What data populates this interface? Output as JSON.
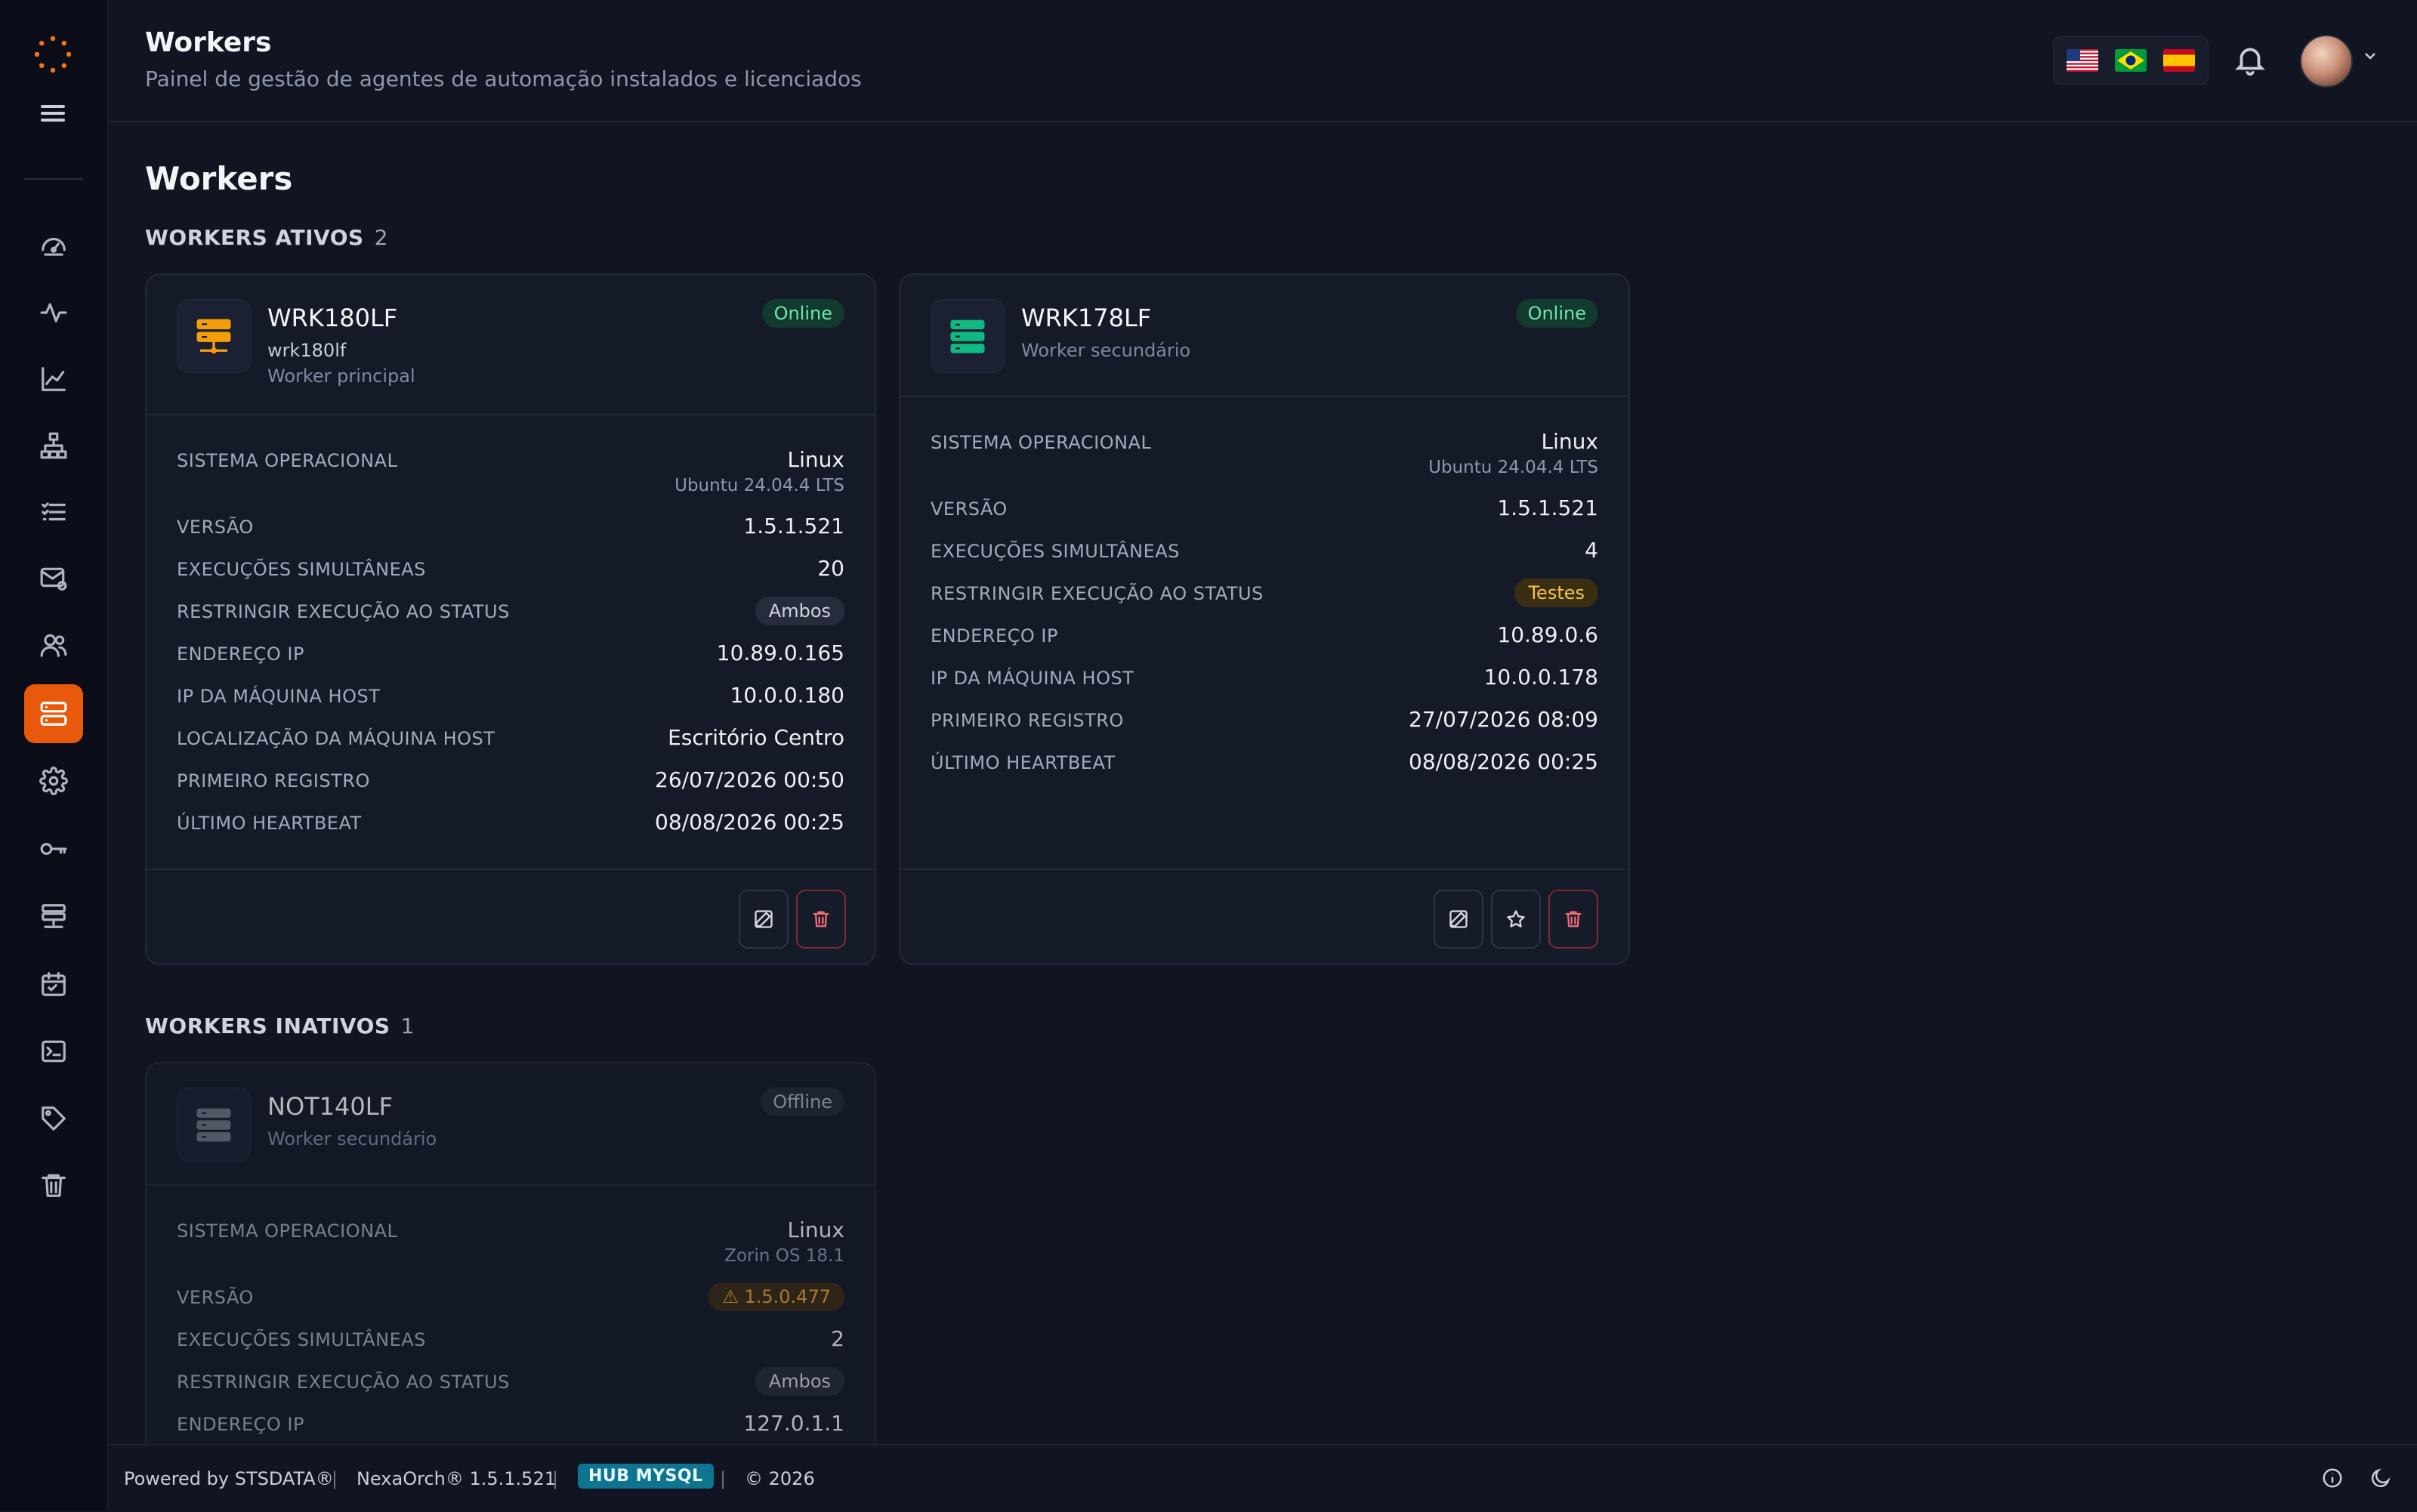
{
  "header": {
    "title": "Workers",
    "subtitle": "Painel de gestão de agentes de automação instalados e licenciados",
    "languages": [
      "en-US",
      "pt-BR",
      "es-ES"
    ]
  },
  "page": {
    "title": "Workers"
  },
  "sections": {
    "active": {
      "title": "WORKERS ATIVOS",
      "count": "2"
    },
    "inactive": {
      "title": "WORKERS INATIVOS",
      "count": "1"
    }
  },
  "labels": {
    "os": "SISTEMA OPERACIONAL",
    "version": "VERSÃO",
    "concurrent": "EXECUÇÕES SIMULTÂNEAS",
    "restrict": "RESTRINGIR EXECUÇÃO AO STATUS",
    "ip": "ENDEREÇO IP",
    "host_ip": "IP DA MÁQUINA HOST",
    "host_location": "LOCALIZAÇÃO DA MÁQUINA HOST",
    "first_register": "PRIMEIRO REGISTRO",
    "last_heartbeat": "ÚLTIMO HEARTBEAT"
  },
  "workers": [
    {
      "name": "WRK180LF",
      "hostname": "wrk180lf",
      "role": "Worker principal",
      "status": "Online",
      "os": "Linux",
      "os_detail": "Ubuntu 24.04.4 LTS",
      "version": "1.5.1.521",
      "concurrent": "20",
      "restrict": "Ambos",
      "ip": "10.89.0.165",
      "host_ip": "10.0.0.180",
      "host_location": "Escritório Centro",
      "first_register": "26/07/2026 00:50",
      "last_heartbeat": "08/08/2026 00:25",
      "icon_color": "#f59e0b"
    },
    {
      "name": "WRK178LF",
      "role": "Worker secundário",
      "status": "Online",
      "os": "Linux",
      "os_detail": "Ubuntu 24.04.4 LTS",
      "version": "1.5.1.521",
      "concurrent": "4",
      "restrict": "Testes",
      "ip": "10.89.0.6",
      "host_ip": "10.0.0.178",
      "first_register": "27/07/2026 08:09",
      "last_heartbeat": "08/08/2026 00:25",
      "icon_color": "#10b981"
    },
    {
      "name": "NOT140LF",
      "role": "Worker secundário",
      "status": "Offline",
      "os": "Linux",
      "os_detail": "Zorin OS 18.1",
      "version": "1.5.0.477",
      "concurrent": "2",
      "restrict": "Ambos",
      "ip": "127.0.1.1",
      "icon_color": "#6b7280"
    }
  ],
  "footer": {
    "powered": "Powered by STSDATA®",
    "product": "NexaOrch® 1.5.1.521",
    "hub": "HUB MYSQL",
    "copyright": "© 2026"
  },
  "colors": {
    "accent": "#e8590c",
    "online": "#6ee7a9",
    "warning": "#f5c542",
    "background": "#111522"
  }
}
